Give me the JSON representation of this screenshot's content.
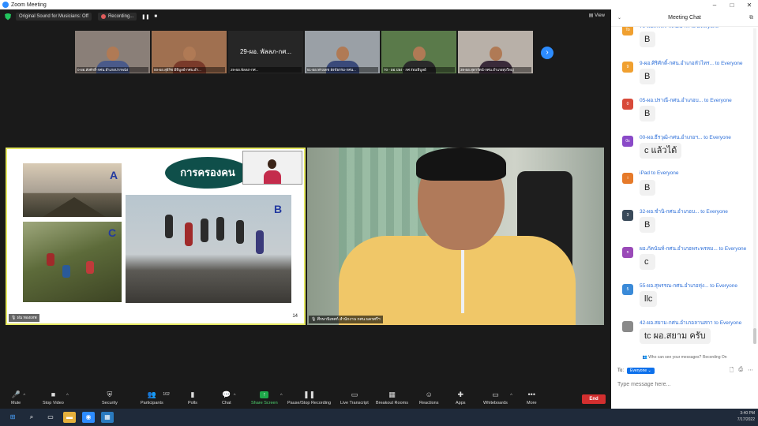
{
  "window": {
    "title": "Zoom Meeting",
    "minimize": "–",
    "maximize": "□",
    "close": "✕"
  },
  "topbar": {
    "sound_label": "Original Sound for Musicians: Off",
    "recording_label": "Recording...",
    "pause_icon": "❚❚",
    "stop_icon": "■",
    "view_label": "View"
  },
  "thumbnails": [
    {
      "label": "0-ผอ.สังศักดิ์-กศน.อำเภอปากพนัง",
      "bg": "#8a7f78",
      "shirt": "#4a5a8a",
      "type": "video"
    },
    {
      "label": "00-ผอ.สุธีรัช มีพิบูลย์-กศน.อำ...",
      "bg": "#a07050",
      "shirt": "#7a3a2a",
      "type": "video"
    },
    {
      "label": "29-ผอ.พัลลภ-กศ...",
      "bg": "#262626",
      "shirt": "#262626",
      "type": "name",
      "bigname": "29-ผอ. พัลลภ-กศ..."
    },
    {
      "label": "51-ผอ.ทรงเดช สังข์ธรรม-กศน...",
      "bg": "#9aa0a6",
      "shirt": "#3a4a7a",
      "type": "video"
    },
    {
      "label": "70 - ผอ.ปอง - กศ.ร่อนพิบูลย์",
      "bg": "#5a7a4a",
      "shirt": "#2a2a2a",
      "type": "video"
    },
    {
      "label": "39-ผอ.สุดารัตน์-กศน.อำเภอทุ่งใหญ่",
      "bg": "#b8b0a8",
      "shirt": "#3a2a3a",
      "type": "video"
    }
  ],
  "share": {
    "slide_title": "การครองคน",
    "letters": [
      "A",
      "B",
      "C"
    ],
    "page_number": "14",
    "presenter_label": "ฝน ทองเทพ",
    "video_label": "ศึกษานิเทศก์ สำนักงาน กศน.นครศรีฯ"
  },
  "toolbar": {
    "mute": "Mute",
    "stop_video": "Stop Video",
    "security": "Security",
    "participants": "Participants",
    "participants_count": "102",
    "polls": "Polls",
    "chat": "Chat",
    "share_screen": "Share Screen",
    "pause_recording": "Pause/Stop Recording",
    "live_transcript": "Live Transcript",
    "breakout_rooms": "Breakout Rooms",
    "reactions": "Reactions",
    "apps": "Apps",
    "whiteboards": "Whiteboards",
    "more": "More",
    "end": "End"
  },
  "chat": {
    "title": "Meeting Chat",
    "messages": [
      {
        "avatar": "To",
        "color": "#f0a030",
        "sender": "79-ผอ.ศิริพร-กศน.อำ... to Everyone",
        "text": "B"
      },
      {
        "avatar": "9",
        "color": "#f0a030",
        "sender": "9-ผอ.ศิริศักดิ์-กศน.อำเภอหัวไทร... to Everyone",
        "text": "B"
      },
      {
        "avatar": "0",
        "color": "#d84a3a",
        "sender": "05-ผอ.ปราณี-กศน.อำเภอบ... to Everyone",
        "text": "B"
      },
      {
        "avatar": "0s",
        "color": "#8a4ac8",
        "sender": "00-ผอ.ธีรวุฒิ-กศน.อำเภอฯ... to Everyone",
        "text": "c แล้วได้"
      },
      {
        "avatar": "i",
        "color": "#e67a2a",
        "sender": "iPad to Everyone",
        "text": "B"
      },
      {
        "avatar": "3",
        "color": "#3a4a5a",
        "sender": "32-ผอ.ชำนิ-กศน.อำเภอบ... to Everyone",
        "text": "B"
      },
      {
        "avatar": "n",
        "color": "#9a4ab8",
        "sender": "ผอ.ภัคนันท์-กศน.อำเภอพระพรหม... to Everyone",
        "text": "c"
      },
      {
        "avatar": "5",
        "color": "#3a8ad8",
        "sender": "55-ผอ.สุพรรณ-กศน.อำเภอทุ่ง... to Everyone",
        "text": "llc"
      },
      {
        "avatar": "",
        "color": "#8a8a8a",
        "sender": "42-ผอ.สยาม-กศน.อำเภอลานสกา to Everyone",
        "text": "tc ผอ.สยาม ครับ"
      }
    ],
    "who_can_see": "Who can see your messages? Recording On",
    "to_label": "To:",
    "to_value": "Everyone",
    "input_placeholder": "Type message here..."
  },
  "taskbar": {
    "time": "3:40 PM",
    "date": "7/17/2022"
  }
}
